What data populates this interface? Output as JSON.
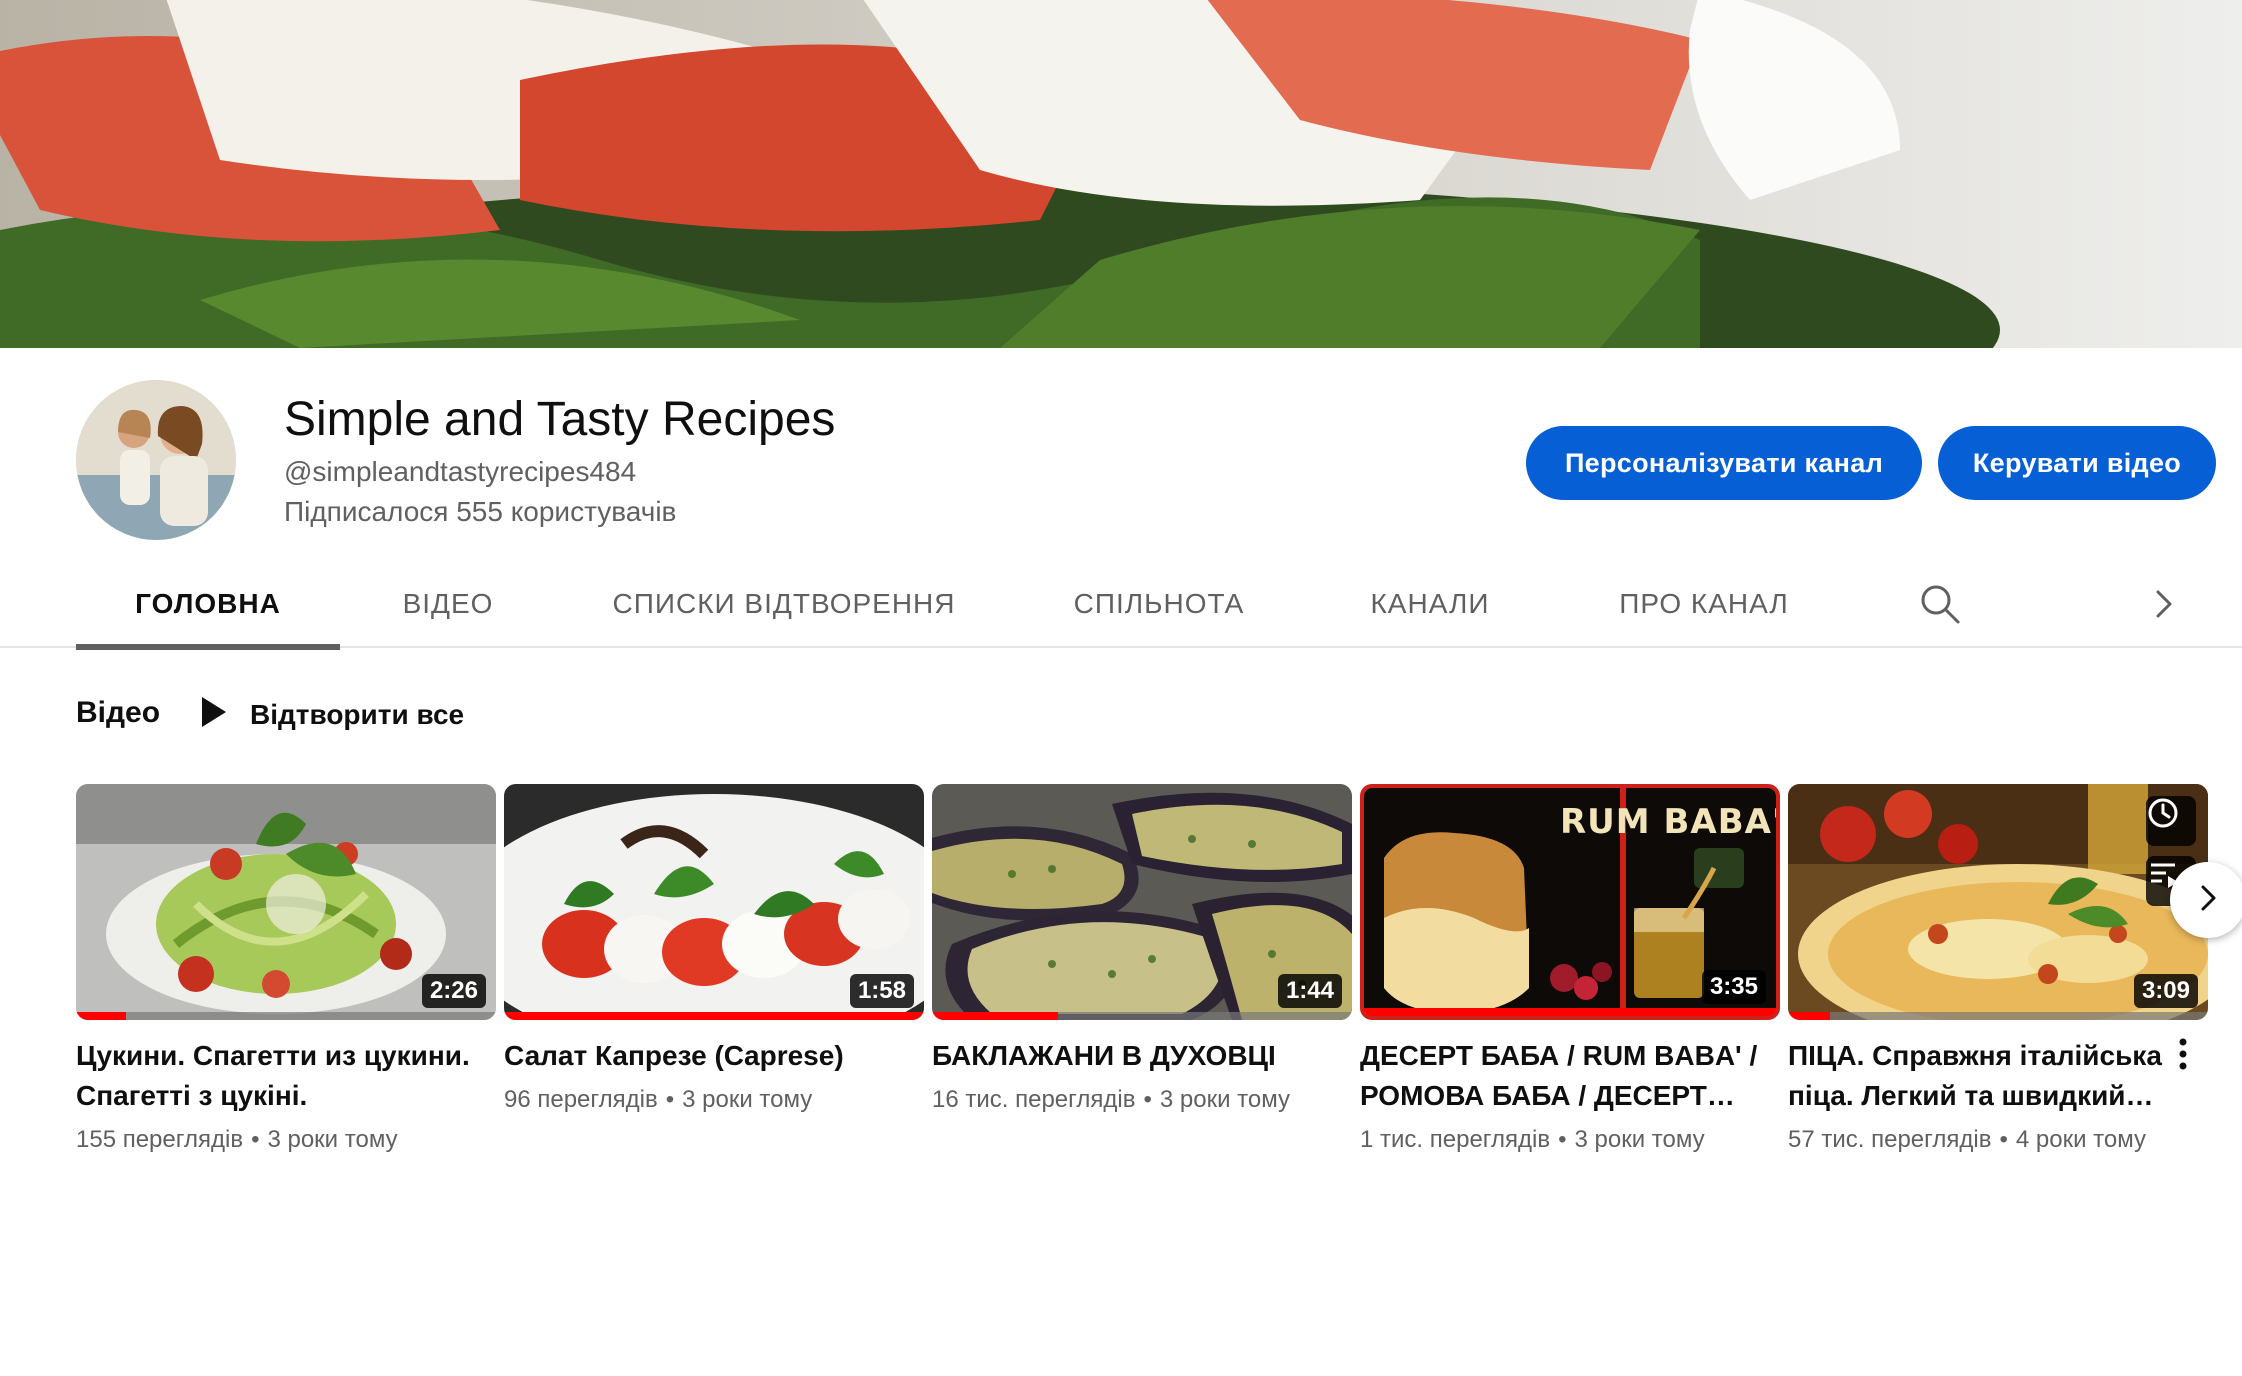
{
  "channel": {
    "name": "Simple and Tasty Recipes",
    "handle": "@simpleandtastyrecipes484",
    "subscribers": "Підписалося 555 користувачів"
  },
  "actions": {
    "customize_label": "Персоналізувати канал",
    "manage_label": "Керувати відео"
  },
  "tabs": [
    {
      "label": "ГОЛОВНА",
      "active": true
    },
    {
      "label": "ВІДЕО",
      "active": false
    },
    {
      "label": "СПИСКИ ВІДТВОРЕННЯ",
      "active": false
    },
    {
      "label": "СПІЛЬНОТА",
      "active": false
    },
    {
      "label": "КАНАЛИ",
      "active": false
    },
    {
      "label": "ПРО КАНАЛ",
      "active": false
    }
  ],
  "section": {
    "title": "Відео",
    "play_all": "Відтворити все"
  },
  "videos": [
    {
      "title": "Цукини. Спагетти из цукини. Спагетті з цукіні.",
      "duration": "2:26",
      "views": "155 переглядів",
      "age": "3 роки тому",
      "watched": 0.12
    },
    {
      "title": "Салат Капрезе (Caprese)",
      "duration": "1:58",
      "views": "96 переглядів",
      "age": "3 роки тому",
      "watched": 1.0
    },
    {
      "title": "БАКЛАЖАНИ В ДУХОВЦІ",
      "duration": "1:44",
      "views": "16 тис. переглядів",
      "age": "3 роки тому",
      "watched": 0.3
    },
    {
      "title": "ДЕСЕРТ БАБА / RUM BABA' / РОМОВА БАБА / ДЕСЕРТ РОМОВА БАБА",
      "duration": "3:35",
      "views": "1 тис. переглядів",
      "age": "3 роки тому",
      "watched": 1.0,
      "overlay_text": "RUM BABA'"
    },
    {
      "title": "ПІЦА. Справжня італійська піца. Легкий та швидкий рецепт",
      "duration": "3:09",
      "views": "57 тис. переглядів",
      "age": "4 роки тому",
      "watched": 0.1
    }
  ],
  "icons": {
    "search": "search-icon",
    "tabs_next": "chevron-right-icon",
    "play": "play-icon",
    "watch_later": "clock-icon",
    "add_queue": "queue-icon",
    "more": "more-vert-icon",
    "carousel_next": "chevron-right-icon"
  },
  "colors": {
    "accent": "#065fd4",
    "progress": "#ff0000"
  }
}
